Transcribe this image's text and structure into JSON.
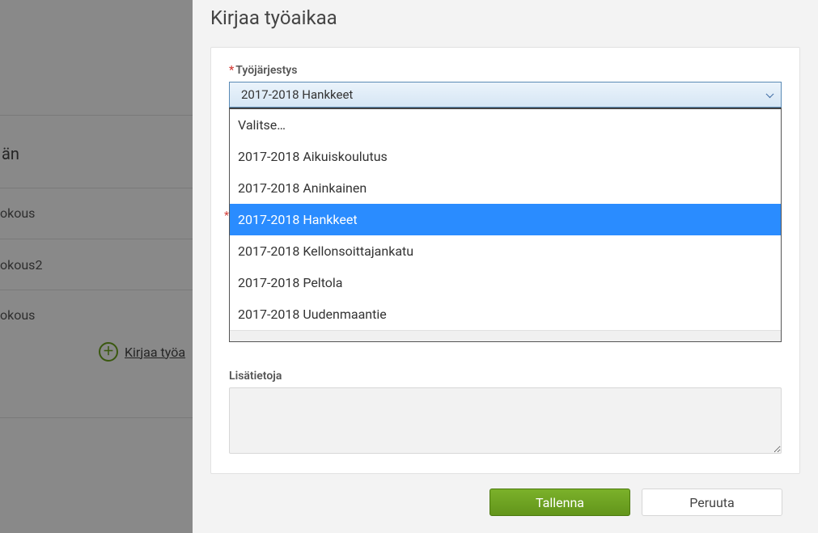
{
  "background": {
    "section_title_suffix": "än",
    "items": [
      "okous",
      "okous2",
      "okous"
    ],
    "add_link_text": "Kirjaa työa"
  },
  "modal": {
    "title": "Kirjaa työaikaa",
    "order_label": "Työjärjestys",
    "order_selected": "2017-2018 Hankkeet",
    "order_options": [
      "Valitse…",
      "2017-2018 Aikuiskoulutus",
      "2017-2018 Aninkainen",
      "2017-2018 Hankkeet",
      "2017-2018 Kellonsoittajankatu",
      "2017-2018 Peltola",
      "2017-2018 Uudenmaantie"
    ],
    "highlighted_option": "2017-2018 Hankkeet",
    "details_label": "Lisätietoja",
    "details_value": "",
    "save_label": "Tallenna",
    "cancel_label": "Peruuta"
  }
}
